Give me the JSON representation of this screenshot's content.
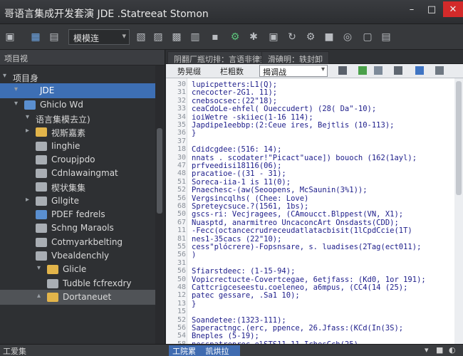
{
  "window": {
    "title": "哥语言集成开发套演 JDE .Statreeat Stomon",
    "min_icon": "minimize-icon",
    "max_icon": "maximize-icon",
    "close_icon": "close-icon"
  },
  "toolbar": {
    "project_combo_value": "模模连",
    "icons": [
      "dock-icon",
      "new-file-icon",
      "open-icon",
      "save-icon",
      "save-all-icon",
      "run-icon",
      "debug-icon",
      "settings-icon",
      "refresh-icon",
      "branch-icon",
      "help-icon",
      "package-icon"
    ]
  },
  "left_panel": {
    "header": "项目视",
    "items": [
      {
        "label": "项目身",
        "expander": "▾",
        "icon": "none"
      },
      {
        "label": "JDE",
        "expander": "▾",
        "icon": "monitor"
      },
      {
        "label": "Ghiclo Wd",
        "expander": "▾",
        "icon": "blue"
      },
      {
        "label": "语言集模去立)",
        "expander": "▾",
        "icon": "none"
      },
      {
        "label": "视斯嘉素",
        "expander": "▸",
        "icon": "yellow"
      },
      {
        "label": "Iinghie",
        "expander": "",
        "icon": "gray"
      },
      {
        "label": "Croupjpdo",
        "expander": "",
        "icon": "gray"
      },
      {
        "label": "Cdnlawaingmat",
        "expander": "",
        "icon": "gray"
      },
      {
        "label": "楔状集集",
        "expander": "",
        "icon": "gray"
      },
      {
        "label": "Gllgite",
        "expander": "▸",
        "icon": "gray"
      },
      {
        "label": "PDEF fedrels",
        "expander": "",
        "icon": "blue"
      },
      {
        "label": "Schng Maraols",
        "expander": "",
        "icon": "gray"
      },
      {
        "label": "Cotmyarkbelting",
        "expander": "",
        "icon": "gray"
      },
      {
        "label": "Vbealdenchly",
        "expander": "",
        "icon": "gray"
      },
      {
        "label": "Glicle",
        "expander": "▾",
        "icon": "yellow"
      },
      {
        "label": "Tudble fcfrexdry",
        "expander": "",
        "icon": "gray"
      },
      {
        "label": "Dortaneuet",
        "expander": "▴",
        "icon": "yellow"
      }
    ]
  },
  "editor": {
    "tabs": [
      "阴翻厂瓶切排：言语非律梦？",
      "滑碘明：轶封卸"
    ],
    "bar": {
      "label1": "势晃缀",
      "label2": "栏粗数",
      "combo_value": "揭调战"
    },
    "lines": [
      {
        "n": "30",
        "t": "lupicpetters:L1(Q);"
      },
      {
        "n": "31",
        "t": "  cnecocter-2G1. 11);"
      },
      {
        "n": "32",
        "t": "  cnebsocsec:(22\"18);"
      },
      {
        "n": "33",
        "t": "  ceaCdoLe-ehfel( Oueccudert) (28( Da\"-10);"
      },
      {
        "n": "34",
        "t": "  ioiWetre -skiiec(1-16 114);"
      },
      {
        "n": "35",
        "t": "  Japdipe1eebbp:(2:Ceue ires, Bejtlis (10-113);"
      },
      {
        "n": "36",
        "t": "}"
      },
      {
        "n": "37",
        "t": ""
      },
      {
        "n": "18",
        "t": "  Cdidcgdee:(516: 14);"
      },
      {
        "n": "30",
        "t": "  nnats . scodater!\"Picact\"uace]) bouoch (162(1ayl);"
      },
      {
        "n": "47",
        "t": "    prfveedisi18116(06);"
      },
      {
        "n": "48",
        "t": "    pracatioe-((31 - 31);"
      },
      {
        "n": "51",
        "t": "    Soreca-iia-1 is 11(0);"
      },
      {
        "n": "52",
        "t": "    Pnaechesc-(aw(Seoopens, McSaunin(3%1));"
      },
      {
        "n": "56",
        "t": "      Vergsincqlhs( (Chee: Love)"
      },
      {
        "n": "68",
        "t": "      Spreteycsuce.?(1561, 1bs);"
      },
      {
        "n": "50",
        "t": "        gscs-ri: Vecjragees, (CAmoucct.Blppest(VN, X1);"
      },
      {
        "n": "67",
        "t": "        Nuasptd, anarmitreo UncaconcArt Onsdasts(CDD);"
      },
      {
        "n": "11",
        "t": "    -Fecc(octancecrudreceudatlatacbisit(1lCpdCcie(1T)"
      },
      {
        "n": "81",
        "t": "    nes1-35cacs (22\"10);"
      },
      {
        "n": "55",
        "t": "    cess\"plócrere)-Fopsnsare, s. luadises(2Tag(ect011);"
      },
      {
        "n": "56",
        "t": "  )"
      },
      {
        "n": "31",
        "t": ""
      },
      {
        "n": "56",
        "t": "    Sfiarstdeec: (1-15-94);"
      },
      {
        "n": "50",
        "t": "    Vopicrectucte-Covertcegae, 6etjfass: (Kd0, 1or 191);"
      },
      {
        "n": "48",
        "t": "    Cattcrigceseestu.coeleneo, a6mpus, (CC4(14 (25);"
      },
      {
        "n": "12",
        "t": "    patec gessare, .Sa1 10);"
      },
      {
        "n": "13",
        "t": "  }"
      },
      {
        "n": "15",
        "t": ""
      },
      {
        "n": "52",
        "t": "  Soandetee:(1323-111);"
      },
      {
        "n": "56",
        "t": "    Saperactngc.(erc, ppence, 26.Jfass:(KCd(In(3S);"
      },
      {
        "n": "54",
        "t": "    Bneples (5-19);"
      },
      {
        "n": "58",
        "t": "    nesspatreprec-elSTS11.11.IchesCch(25)"
      }
    ]
  },
  "status": {
    "left": "工爱集",
    "tab": "工院累",
    "right_tab": "凯烘拉",
    "right_items": [
      "▾",
      "■",
      "◐"
    ]
  }
}
